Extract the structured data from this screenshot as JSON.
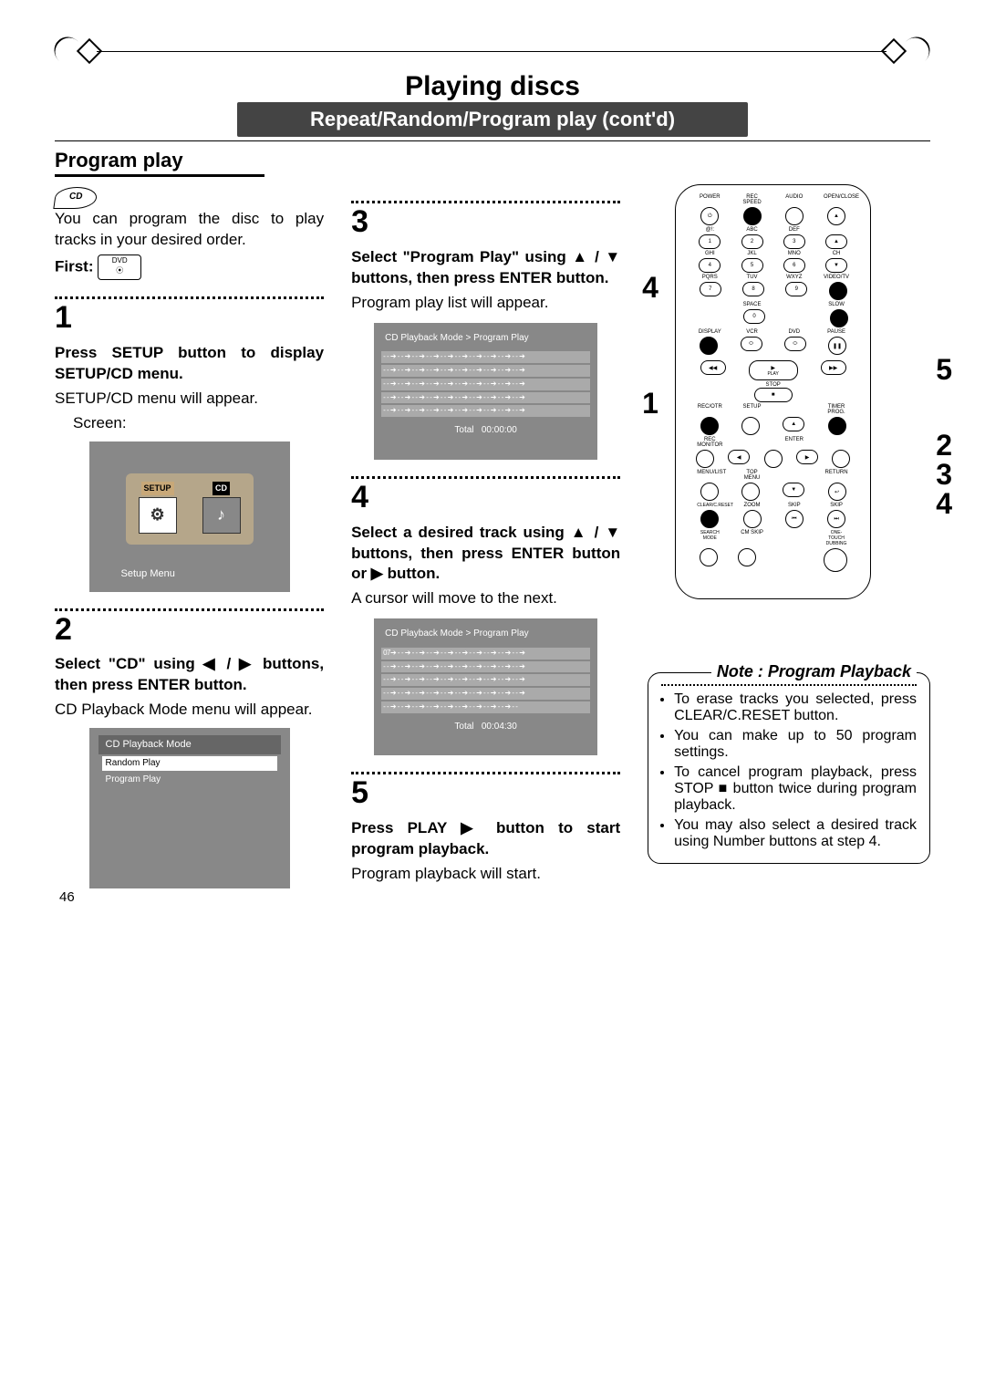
{
  "page_number": "46",
  "header": {
    "title": "Playing discs",
    "subtitle": "Repeat/Random/Program play (cont'd)"
  },
  "section": {
    "title": "Program play"
  },
  "intro": "You can program the disc to play tracks in your desired order.",
  "first_label": "First:",
  "step1": {
    "num": "1",
    "bold": "Press SETUP button to display SETUP/CD menu.",
    "text": "SETUP/CD menu will appear.",
    "screen_label": "Screen:",
    "setup_tab": "SETUP",
    "cd_tab": "CD",
    "caption": "Setup Menu"
  },
  "step2": {
    "num": "2",
    "bold": "Select \"CD\" using ◀ / ▶ buttons, then press ENTER button.",
    "text": "CD Playback Mode menu will appear.",
    "menu_title": "CD Playback Mode",
    "menu_items": [
      "Random Play",
      "Program Play"
    ]
  },
  "step3": {
    "num": "3",
    "bold": "Select \"Program Play\" using ▲ / ▼ buttons, then press ENTER button.",
    "text": "Program play list will appear.",
    "screen_title": "CD Playback Mode > Program Play",
    "row": "- - ➔ - - ➔ - - ➔ - - ➔ - - ➔ - - ➔ - - ➔ - - ➔ - - ➔ - - ➔",
    "total_label": "Total",
    "total_time": "00:00:00"
  },
  "step4": {
    "num": "4",
    "bold": "Select a desired track using ▲ / ▼ buttons, then press ENTER button or ▶ button.",
    "text": "A cursor will move to the next.",
    "screen_title": "CD Playback Mode > Program Play",
    "row_first": "07➔ - - ➔ - - ➔ - - ➔ - - ➔ - - ➔ - - ➔ - - ➔ - - ➔ - - ➔",
    "row": "- - ➔ - - ➔ - - ➔ - - ➔ - - ➔ - - ➔ - - ➔ - - ➔ - - ➔ - - ➔",
    "row_last": "- - ➔ - - ➔ - - ➔ - - ➔ - - ➔ - - ➔ - - ➔ - - ➔ - - ➔ - -",
    "total_label": "Total",
    "total_time": "00:04:30"
  },
  "step5": {
    "num": "5",
    "bold": "Press PLAY ▶ button to start program playback.",
    "text": "Program playback will start."
  },
  "remote": {
    "side_left_4": "4",
    "side_left_1": "1",
    "side_right_5": "5",
    "side_right_2": "2",
    "side_right_3": "3",
    "side_right_4": "4",
    "labels": {
      "r1": [
        "POWER",
        "REC SPEED",
        "AUDIO",
        "OPEN/CLOSE"
      ],
      "r2": [
        "@!:",
        "ABC",
        "DEF",
        ""
      ],
      "r2b": [
        "1",
        "2",
        "3",
        "▲"
      ],
      "r3": [
        "GHI",
        "JKL",
        "MNO",
        "CH"
      ],
      "r3b": [
        "4",
        "5",
        "6",
        "▼"
      ],
      "r4": [
        "PQRS",
        "TUV",
        "WXYZ",
        "VIDEO/TV"
      ],
      "r4b": [
        "7",
        "8",
        "9",
        ""
      ],
      "r5": [
        "",
        "SPACE",
        "",
        "SLOW"
      ],
      "r5b": [
        "",
        "0",
        "",
        ""
      ],
      "r6": [
        "DISPLAY",
        "VCR",
        "DVD",
        "PAUSE"
      ],
      "play": "PLAY",
      "rew": "◀◀",
      "ff": "▶▶",
      "stop": "STOP",
      "r7": [
        "REC/OTR",
        "SETUP",
        "",
        "TIMER PROG."
      ],
      "r8a": "REC MONITOR",
      "r8b": "ENTER",
      "r9": [
        "MENU/LIST",
        "TOP MENU",
        "",
        "RETURN"
      ],
      "r10": [
        "CLEAR/C.RESET",
        "ZOOM",
        "SKIP",
        "SKIP"
      ],
      "r11": [
        "SEARCH MODE",
        "CM SKIP",
        "",
        "ONE-TOUCH DUBBING"
      ]
    }
  },
  "note": {
    "title": "Note : Program Playback",
    "items": [
      "To erase tracks you selected, press CLEAR/C.RESET button.",
      "You can make up to 50 program settings.",
      "To cancel program playback, press STOP ■ button twice during program playback.",
      "You may also select a desired track using Number buttons at step 4."
    ]
  }
}
